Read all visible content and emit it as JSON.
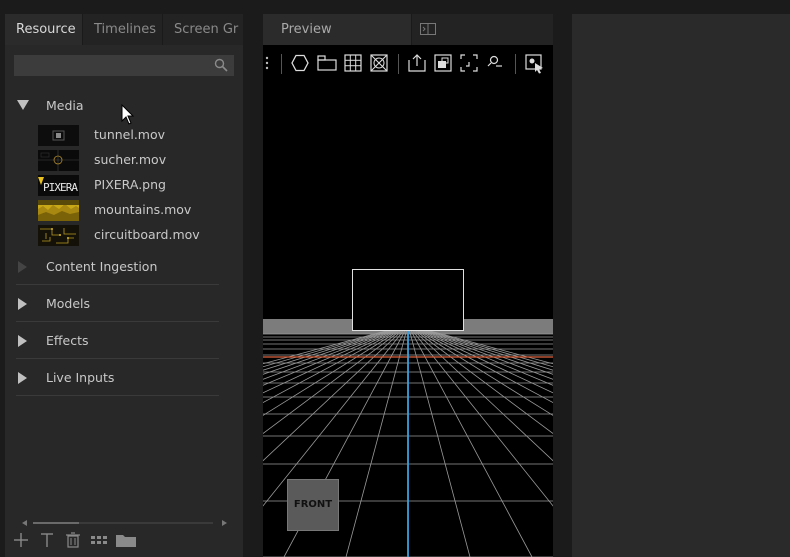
{
  "left_panel": {
    "tabs": [
      {
        "label": "Resource",
        "active": true
      },
      {
        "label": "Timelines",
        "active": false
      },
      {
        "label": "Screen Gr",
        "active": false
      }
    ],
    "search": {
      "value": "",
      "placeholder": ""
    },
    "media_group": {
      "label": "Media",
      "expanded": true,
      "items": [
        {
          "name": "tunnel.mov",
          "thumb": "tunnel-thumb"
        },
        {
          "name": "sucher.mov",
          "thumb": "sucher-thumb"
        },
        {
          "name": "PIXERA.png",
          "thumb": "pixera-thumb"
        },
        {
          "name": "mountains.mov",
          "thumb": "mountains-thumb"
        },
        {
          "name": "circuitboard.mov",
          "thumb": "circuitboard-thumb"
        }
      ]
    },
    "groups": [
      {
        "label": "Content Ingestion",
        "expanded": false,
        "dimmed": true
      },
      {
        "label": "Models",
        "expanded": false,
        "dimmed": false
      },
      {
        "label": "Effects",
        "expanded": false,
        "dimmed": false
      },
      {
        "label": "Live Inputs",
        "expanded": false,
        "dimmed": false
      }
    ],
    "bottom_toolbar": [
      "add-icon",
      "text-icon",
      "trash-icon",
      "grid-view-icon",
      "folder-icon"
    ]
  },
  "preview": {
    "tab_label": "Preview",
    "front_label": "FRONT",
    "toolbar_icons": [
      "more-icon",
      "hexagon-icon",
      "window-icon",
      "grid-icon",
      "box-x-icon",
      "export-icon",
      "screen-icon",
      "frame-icon",
      "zoom-icon",
      "select-icon"
    ]
  },
  "thumb_texts": {
    "pixera": "PIXERA"
  },
  "colors": {
    "panel_bg": "#282828",
    "horizon_line": "#e0643c",
    "axis_line": "#3aa0e0",
    "mountain_yellow": "#c9a818"
  }
}
